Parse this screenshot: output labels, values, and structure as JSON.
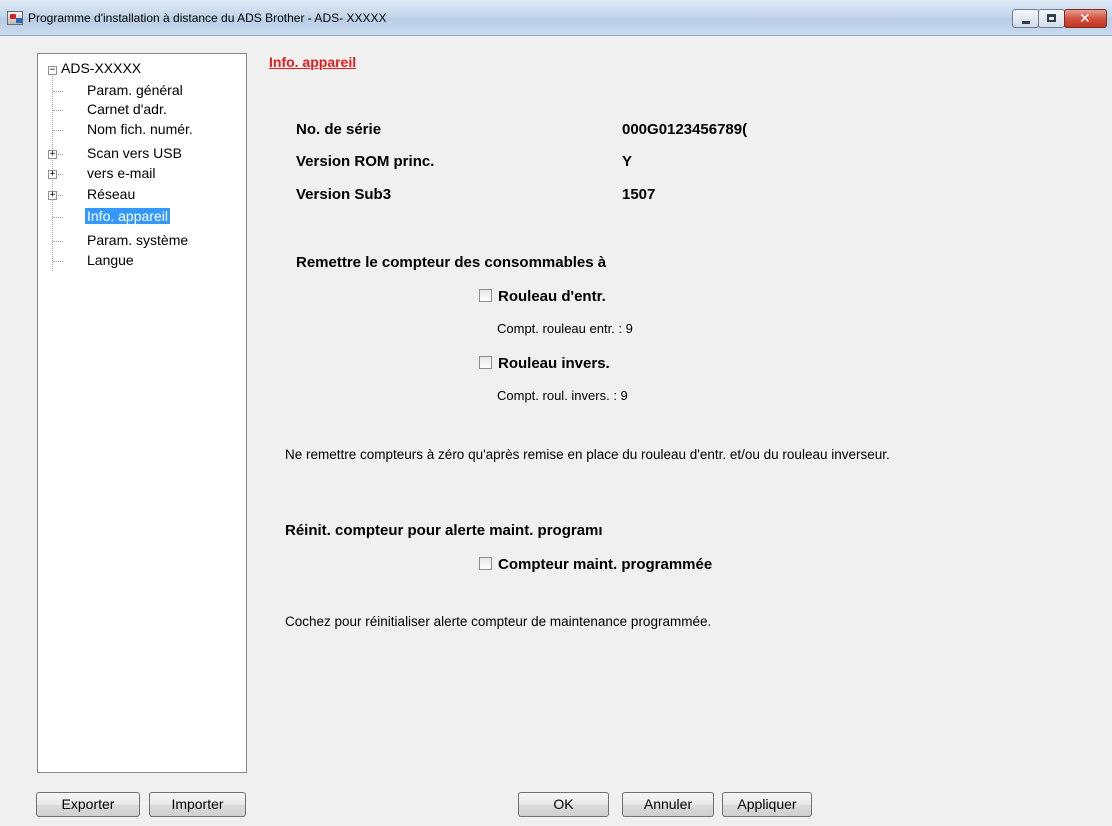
{
  "window": {
    "title": "Programme d'installation à distance du ADS Brother - ADS- XXXXX",
    "close_glyph": "✕"
  },
  "tree": {
    "root": "ADS-XXXXX",
    "items": [
      {
        "label": "Param. général",
        "expandable": false
      },
      {
        "label": "Carnet d'adr.",
        "expandable": false
      },
      {
        "label": "Nom fich. numér.",
        "expandable": false
      },
      {
        "label": "Scan vers USB",
        "expandable": true
      },
      {
        "label": "vers e-mail",
        "expandable": true
      },
      {
        "label": "Réseau",
        "expandable": true
      },
      {
        "label": "Info. appareil",
        "expandable": false,
        "selected": true
      },
      {
        "label": "Param. système",
        "expandable": false
      },
      {
        "label": "Langue",
        "expandable": false
      }
    ]
  },
  "main": {
    "heading": "Info. appareil",
    "info": {
      "serial_label": "No. de série",
      "serial_value": "000G0123456789(",
      "rom_label": "Version ROM princ.",
      "rom_value": "Y",
      "sub3_label": "Version Sub3",
      "sub3_value": "1507"
    },
    "reset_section": {
      "title": "Remettre le compteur des consommables à",
      "roller1_label": "Rouleau d'entr.",
      "roller1_count": "Compt. rouleau entr. : 9",
      "roller2_label": "Rouleau invers.",
      "roller2_count": "Compt. roul. invers. : 9",
      "note": "Ne remettre compteurs à zéro qu'après remise en place du rouleau d'entr. et/ou du rouleau inverseur."
    },
    "maint_section": {
      "title": "Réinit. compteur pour alerte maint. programı",
      "checkbox_label": "Compteur maint. programmée",
      "note": "Cochez pour réinitialiser alerte compteur de maintenance programmée."
    }
  },
  "buttons": {
    "export": "Exporter",
    "import": "Importer",
    "ok": "OK",
    "cancel": "Annuler",
    "apply": "Appliquer"
  },
  "colors": {
    "heading": "#e81b1b",
    "selection": "#3399ff"
  }
}
